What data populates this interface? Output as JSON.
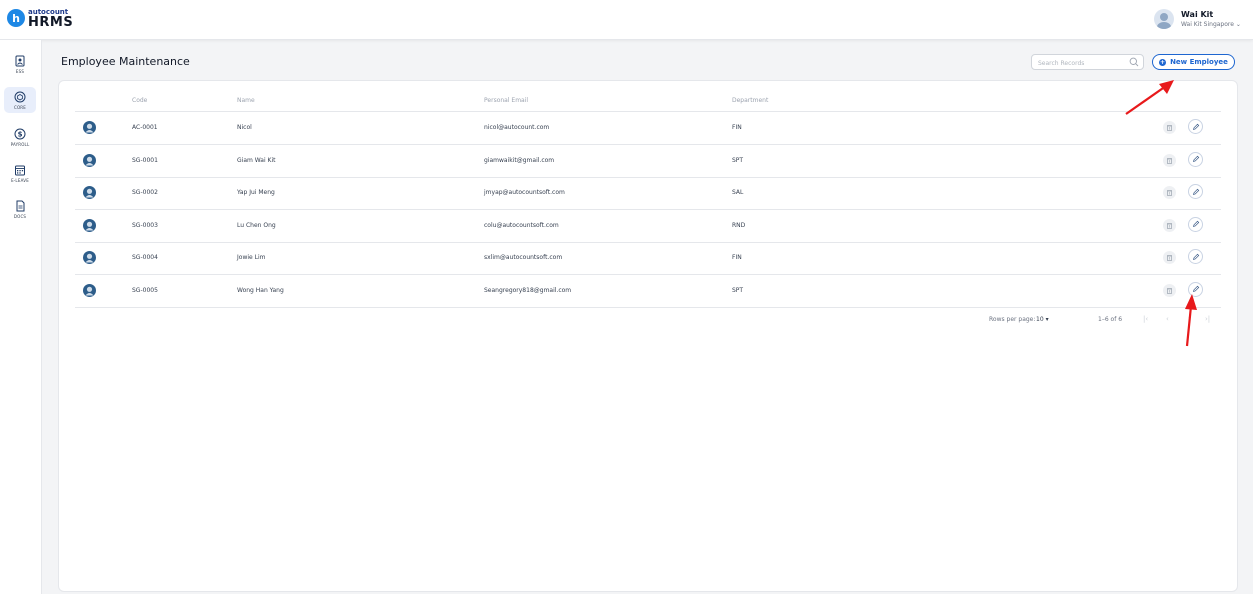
{
  "app": {
    "logo_small": "autocount",
    "logo_big": "HRMS",
    "logo_letter": "h"
  },
  "user": {
    "name": "Wai Kit",
    "company": "Wai Kit Singapore ⌄"
  },
  "sidebar": {
    "items": [
      {
        "label": "ESS",
        "icon": "ess-icon"
      },
      {
        "label": "CORE",
        "icon": "core-icon",
        "active": true
      },
      {
        "label": "PAYROLL",
        "icon": "payroll-icon"
      },
      {
        "label": "E-LEAVE",
        "icon": "calendar-icon"
      },
      {
        "label": "DOCS",
        "icon": "docs-icon"
      }
    ]
  },
  "page": {
    "title": "Employee Maintenance",
    "search_placeholder": "Search Records",
    "new_button": "New Employee"
  },
  "table": {
    "headers": [
      "Code",
      "Name",
      "Personal Email",
      "Department"
    ],
    "rows": [
      {
        "code": "AC-0001",
        "name": "Nicol",
        "email": "nicol@autocount.com",
        "dept": "FIN"
      },
      {
        "code": "SG-0001",
        "name": "Giam Wai Kit",
        "email": "giamwaikit@gmail.com",
        "dept": "SPT"
      },
      {
        "code": "SG-0002",
        "name": "Yap Jui Meng",
        "email": "jmyap@autocountsoft.com",
        "dept": "SAL"
      },
      {
        "code": "SG-0003",
        "name": "Lu Chen Ong",
        "email": "colu@autocountsoft.com",
        "dept": "RND"
      },
      {
        "code": "SG-0004",
        "name": "Jowie Lim",
        "email": "sxlim@autocountsoft.com",
        "dept": "FIN"
      },
      {
        "code": "SG-0005",
        "name": "Wong Han Yang",
        "email": "Seangregory818@gmail.com",
        "dept": "SPT"
      }
    ]
  },
  "pagination": {
    "rows_per_page_label": "Rows per page:",
    "rows_per_page_value": "10",
    "range": "1–6 of 6"
  },
  "colors": {
    "accent": "#1e66d0",
    "annotation": "#e8191b"
  }
}
